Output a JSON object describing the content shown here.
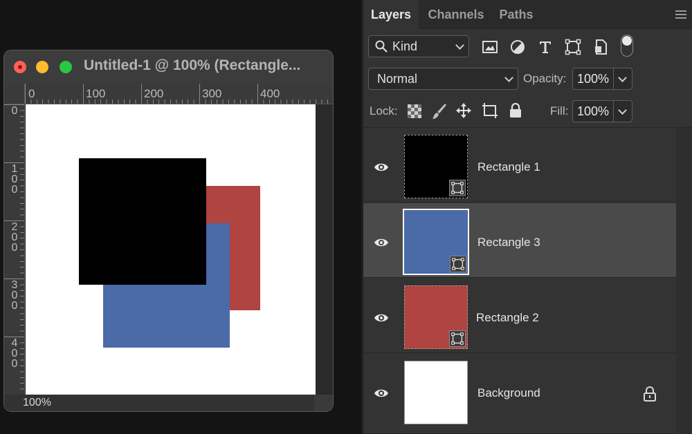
{
  "document": {
    "title": "Untitled-1 @ 100% (Rectangle...",
    "zoom": "100%",
    "ruler_h_labels": [
      "0",
      "100",
      "200",
      "300",
      "400"
    ],
    "ruler_v_labels": [
      "0",
      "100",
      "200",
      "300",
      "400"
    ],
    "shapes": [
      {
        "name": "Rectangle 2",
        "color": "#b04440"
      },
      {
        "name": "Rectangle 3",
        "color": "#4b6aa8"
      },
      {
        "name": "Rectangle 1",
        "color": "#000000"
      }
    ]
  },
  "panel": {
    "tabs": [
      "Layers",
      "Channels",
      "Paths"
    ],
    "active_tab": "Layers",
    "filter": {
      "label": "Kind",
      "icons": [
        "image-filter-icon",
        "adjustment-filter-icon",
        "type-filter-icon",
        "shape-filter-icon",
        "smart-object-filter-icon"
      ]
    },
    "blend_mode": "Normal",
    "opacity_label": "Opacity:",
    "opacity": "100%",
    "lock_label": "Lock:",
    "lock_icons": [
      "lock-transparent-pixels-icon",
      "lock-image-pixels-icon",
      "lock-position-icon",
      "artboard-autonest-icon",
      "lock-all-icon"
    ],
    "fill_label": "Fill:",
    "fill": "100%",
    "layers": [
      {
        "name": "Rectangle 1",
        "color": "#000000",
        "selected": false,
        "shape": true,
        "locked": false
      },
      {
        "name": "Rectangle 3",
        "color": "#4b6aa8",
        "selected": true,
        "shape": true,
        "locked": false
      },
      {
        "name": "Rectangle 2",
        "color": "#b04440",
        "selected": false,
        "shape": true,
        "locked": false
      },
      {
        "name": "Background",
        "color": "#ffffff",
        "selected": false,
        "shape": false,
        "locked": true
      }
    ]
  }
}
